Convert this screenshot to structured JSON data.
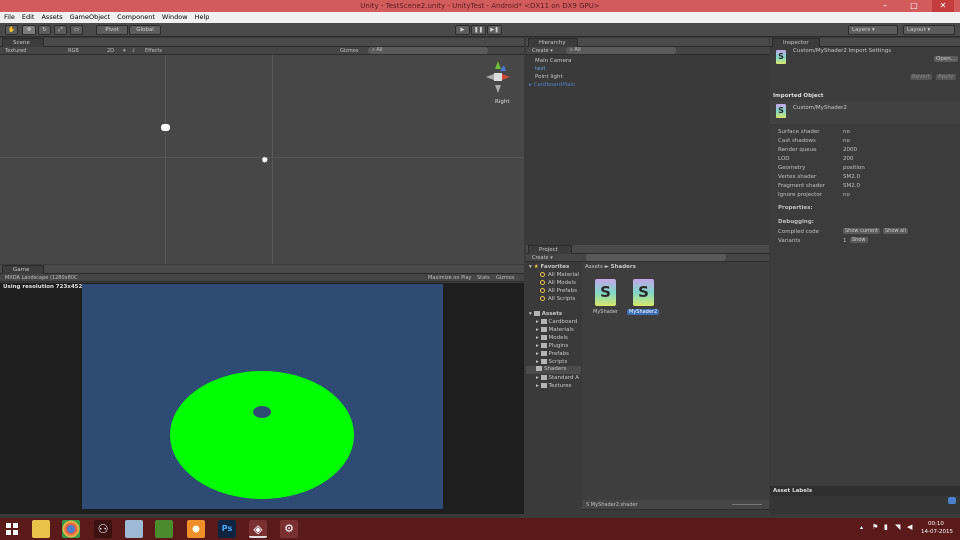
{
  "window": {
    "title": "Unity - TestScene2.unity - UnityTest - Android* <DX11 on DX9 GPU>",
    "min": "–",
    "max": "□",
    "close": "✕"
  },
  "menu": [
    "File",
    "Edit",
    "Assets",
    "GameObject",
    "Component",
    "Window",
    "Help"
  ],
  "toolbar": {
    "pivot": "Pivot",
    "global": "Global",
    "layers": "Layers",
    "layout": "Layout"
  },
  "scene": {
    "tab": "Scene",
    "shading": "Textured",
    "rgb": "RGB",
    "mode2d": "2D",
    "effects": "Effects",
    "gizmos": "Gizmos",
    "all": "All",
    "orientation": "Right"
  },
  "hierarchy": {
    "tab": "Hierarchy",
    "create": "Create",
    "all": "All",
    "items": [
      {
        "label": "Main Camera",
        "color": "#c8c8c8"
      },
      {
        "label": "test",
        "color": "#6d9ee0"
      },
      {
        "label": "Point light",
        "color": "#c8c8c8"
      },
      {
        "label": "CardboardMain",
        "color": "#4f7dbf"
      }
    ]
  },
  "game": {
    "tab": "Game",
    "aspect": "MXDA Landscape (1280x80C",
    "resolution": "Using resolution 723x452",
    "maximize": "Maximize on Play",
    "stats": "Stats",
    "gizmos": "Gizmos"
  },
  "project": {
    "tab": "Project",
    "create": "Create",
    "favorites": "Favorites",
    "fav_items": [
      "All Material",
      "All Models",
      "All Prefabs",
      "All Scripts"
    ],
    "assets": "Assets",
    "folders": [
      "Cardboard",
      "Materials",
      "Models",
      "Plugins",
      "Prefabs",
      "Scripts",
      "Shaders",
      "Standard A",
      "Textures"
    ],
    "breadcrumb_root": "Assets",
    "breadcrumb_sep": "►",
    "breadcrumb_leaf": "Shaders",
    "files": [
      "MyShader",
      "MyShader2"
    ],
    "footer": "MyShader2.shader"
  },
  "inspector": {
    "tab": "Inspector",
    "title": "Custom/MyShader2 Import Settings",
    "open": "Open...",
    "revert": "Revert",
    "apply": "Apply",
    "imported": "Imported Object",
    "asset_name": "Custom/MyShader2",
    "props": [
      [
        "Surface shader",
        "no"
      ],
      [
        "Cast shadows",
        "no"
      ],
      [
        "Render queue",
        "2000"
      ],
      [
        "LOD",
        "200"
      ],
      [
        "Geometry",
        "position"
      ],
      [
        "Vertex shader",
        "SM2.0"
      ],
      [
        "Fragment shader",
        "SM2.0"
      ],
      [
        "Ignore projector",
        "no"
      ]
    ],
    "properties_label": "Properties:",
    "debugging_label": "Debugging:",
    "compiled_code": "Compiled code",
    "show_current": "Show current",
    "show_all": "Show all",
    "variants": "Variants",
    "variants_count": "1",
    "show": "Show",
    "asset_labels": "Asset Labels"
  },
  "taskbar": {
    "time": "00:10",
    "date": "14-07-2015",
    "ps": "Ps"
  },
  "colors": {
    "title_bar": "#d25c5c",
    "sky": "#2e4b73",
    "disc": "#00ff00",
    "taskbar": "#5b1a1a"
  }
}
